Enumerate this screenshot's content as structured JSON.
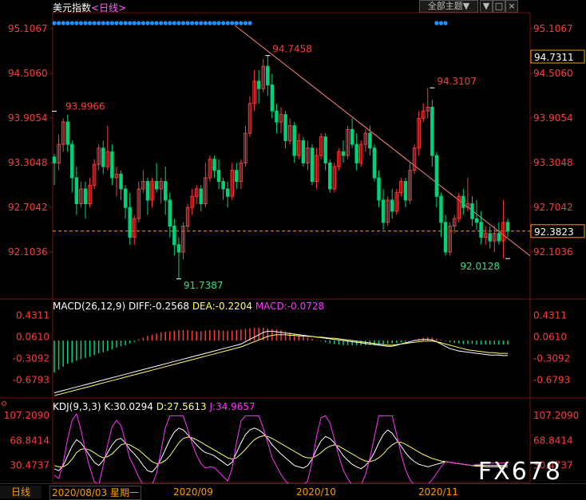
{
  "header": {
    "title": "美元指数",
    "period": "<日线>",
    "theme_button": "全部主题▼",
    "win_buttons": [
      "▼",
      "□",
      "×"
    ]
  },
  "macd": {
    "label": "MACD(26,12,9)",
    "diff": "DIFF:-0.2568",
    "dea": "DEA:-0.2204",
    "macd": "MACD:-0.0728",
    "ticks": [
      "0.4311",
      "0.0610",
      "-0.3092",
      "-0.6793"
    ]
  },
  "kdj": {
    "label": "KDJ(9,3,3)",
    "k": "K:30.0294",
    "d": "D:27.5613",
    "j": "J:34.9657",
    "ticks": [
      "107.2090",
      "68.8414",
      "30.4737"
    ]
  },
  "footer": {
    "period_button": "日线",
    "cursor_date": "2020/08/03 星期一",
    "x_labels": [
      "2020/09",
      "2020/10",
      "2020/11"
    ]
  },
  "watermark": "FX678",
  "colors": {
    "up": "#ff3b3b",
    "down": "#00d27a",
    "trendline": "#ff8080",
    "current_price_line": "#ff9900",
    "diff_line": "#ffffff",
    "dea_line": "#ffff66",
    "macd_label": "#ff33ff",
    "k_line": "#ffffff",
    "d_line": "#ffff66",
    "j_line": "#ff33ff",
    "axis_text": "#ff3b3b",
    "event_dots": "#1e90ff"
  },
  "chart_data": {
    "type": "candlestick",
    "instrument": "美元指数",
    "price_axis_ticks": [
      95.1067,
      94.506,
      93.9054,
      93.3048,
      92.7042,
      92.1036
    ],
    "current_price": "92.3823",
    "price_marker": "94.7311",
    "annotations": {
      "high_label": "94.7458",
      "high2_label": "94.3107",
      "left_label": "93.9966",
      "low_label": "91.7387",
      "low2_label": "92.0128"
    },
    "x_labels": [
      "2020/09",
      "2020/10",
      "2020/11"
    ],
    "candles": [
      [
        93.38,
        93.42,
        93.0,
        93.3
      ],
      [
        93.3,
        93.68,
        93.2,
        93.55
      ],
      [
        93.55,
        93.9,
        93.45,
        93.85
      ],
      [
        93.85,
        93.95,
        93.45,
        93.55
      ],
      [
        93.55,
        93.6,
        92.9,
        93.1
      ],
      [
        93.1,
        93.25,
        92.6,
        92.75
      ],
      [
        92.75,
        93.05,
        92.7,
        92.95
      ],
      [
        92.95,
        93.05,
        92.55,
        92.75
      ],
      [
        92.75,
        93.1,
        92.7,
        93.0
      ],
      [
        93.0,
        93.35,
        92.95,
        93.28
      ],
      [
        93.28,
        93.55,
        93.2,
        93.5
      ],
      [
        93.5,
        93.6,
        93.15,
        93.25
      ],
      [
        93.25,
        93.8,
        93.2,
        93.45
      ],
      [
        93.45,
        93.55,
        93.0,
        93.1
      ],
      [
        93.1,
        93.25,
        92.85,
        93.15
      ],
      [
        93.15,
        93.2,
        92.8,
        92.95
      ],
      [
        92.95,
        93.0,
        92.55,
        92.7
      ],
      [
        92.7,
        92.9,
        92.2,
        92.3
      ],
      [
        92.3,
        92.6,
        92.2,
        92.55
      ],
      [
        92.55,
        93.05,
        92.5,
        92.95
      ],
      [
        92.95,
        93.2,
        92.9,
        93.05
      ],
      [
        93.05,
        93.1,
        92.6,
        92.8
      ],
      [
        92.8,
        93.1,
        92.7,
        93.05
      ],
      [
        93.05,
        93.3,
        92.9,
        92.95
      ],
      [
        92.95,
        93.1,
        92.75,
        93.05
      ],
      [
        93.05,
        93.25,
        92.6,
        92.8
      ],
      [
        92.8,
        92.9,
        92.3,
        92.45
      ],
      [
        92.45,
        92.55,
        92.05,
        92.2
      ],
      [
        92.2,
        92.3,
        91.74,
        92.1
      ],
      [
        92.1,
        92.5,
        92.0,
        92.45
      ],
      [
        92.45,
        92.75,
        92.4,
        92.7
      ],
      [
        92.7,
        92.95,
        92.6,
        92.85
      ],
      [
        92.85,
        93.0,
        92.75,
        92.95
      ],
      [
        92.95,
        93.0,
        92.65,
        92.75
      ],
      [
        92.75,
        93.3,
        92.7,
        93.1
      ],
      [
        93.1,
        93.4,
        93.05,
        93.35
      ],
      [
        93.35,
        93.4,
        93.1,
        93.2
      ],
      [
        93.2,
        93.35,
        92.95,
        93.05
      ],
      [
        93.05,
        93.1,
        92.8,
        92.95
      ],
      [
        92.95,
        93.05,
        92.7,
        92.85
      ],
      [
        92.85,
        93.3,
        92.8,
        93.2
      ],
      [
        93.2,
        93.3,
        92.95,
        93.05
      ],
      [
        93.05,
        93.35,
        92.95,
        93.3
      ],
      [
        93.3,
        93.8,
        93.25,
        93.7
      ],
      [
        93.7,
        94.2,
        93.65,
        94.1
      ],
      [
        94.1,
        94.55,
        94.0,
        94.4
      ],
      [
        94.4,
        94.55,
        94.1,
        94.3
      ],
      [
        94.3,
        94.7,
        94.25,
        94.6
      ],
      [
        94.6,
        94.7458,
        94.2,
        94.35
      ],
      [
        94.35,
        94.5,
        93.9,
        94.0
      ],
      [
        94.0,
        94.1,
        93.7,
        93.85
      ],
      [
        93.85,
        94.05,
        93.7,
        93.95
      ],
      [
        93.95,
        94.0,
        93.5,
        93.6
      ],
      [
        93.6,
        93.9,
        93.55,
        93.8
      ],
      [
        93.8,
        93.85,
        93.3,
        93.4
      ],
      [
        93.4,
        93.7,
        93.35,
        93.6
      ],
      [
        93.6,
        93.65,
        93.25,
        93.3
      ],
      [
        93.3,
        93.6,
        93.2,
        93.5
      ],
      [
        93.5,
        93.55,
        93.0,
        93.05
      ],
      [
        93.05,
        93.5,
        92.95,
        93.4
      ],
      [
        93.4,
        93.7,
        93.35,
        93.65
      ],
      [
        93.65,
        93.7,
        93.2,
        93.3
      ],
      [
        93.3,
        93.35,
        92.9,
        92.95
      ],
      [
        92.95,
        93.3,
        92.9,
        93.25
      ],
      [
        93.25,
        93.5,
        93.2,
        93.45
      ],
      [
        93.45,
        93.6,
        93.3,
        93.4
      ],
      [
        93.4,
        93.8,
        93.35,
        93.75
      ],
      [
        93.75,
        93.9,
        93.5,
        93.55
      ],
      [
        93.55,
        93.7,
        93.2,
        93.3
      ],
      [
        93.3,
        93.6,
        93.25,
        93.55
      ],
      [
        93.55,
        93.75,
        93.45,
        93.7
      ],
      [
        93.7,
        93.8,
        93.4,
        93.5
      ],
      [
        93.5,
        93.55,
        93.05,
        93.1
      ],
      [
        93.1,
        93.2,
        92.7,
        92.8
      ],
      [
        92.8,
        92.95,
        92.4,
        92.5
      ],
      [
        92.5,
        92.85,
        92.45,
        92.8
      ],
      [
        92.8,
        92.95,
        92.55,
        92.65
      ],
      [
        92.65,
        92.95,
        92.6,
        92.9
      ],
      [
        92.9,
        93.1,
        92.85,
        93.05
      ],
      [
        93.05,
        93.1,
        92.7,
        92.8
      ],
      [
        92.8,
        93.3,
        92.75,
        93.2
      ],
      [
        93.2,
        93.55,
        93.15,
        93.5
      ],
      [
        93.5,
        94.0,
        93.4,
        93.9
      ],
      [
        93.9,
        94.1,
        93.85,
        94.0
      ],
      [
        94.0,
        94.3107,
        93.9,
        94.05
      ],
      [
        94.05,
        94.15,
        93.25,
        93.4
      ],
      [
        93.4,
        93.45,
        92.7,
        92.85
      ],
      [
        92.85,
        92.9,
        92.3,
        92.5
      ],
      [
        92.5,
        92.6,
        92.05,
        92.1
      ],
      [
        92.1,
        92.5,
        92.05,
        92.45
      ],
      [
        92.45,
        92.6,
        92.35,
        92.55
      ],
      [
        92.55,
        92.9,
        92.5,
        92.85
      ],
      [
        92.85,
        92.95,
        92.6,
        92.7
      ],
      [
        92.7,
        93.1,
        92.65,
        92.75
      ],
      [
        92.75,
        92.85,
        92.45,
        92.55
      ],
      [
        92.55,
        92.8,
        92.4,
        92.5
      ],
      [
        92.5,
        92.65,
        92.2,
        92.3
      ],
      [
        92.3,
        92.45,
        92.2,
        92.35
      ],
      [
        92.35,
        92.45,
        92.15,
        92.25
      ],
      [
        92.25,
        92.45,
        92.1,
        92.35
      ],
      [
        92.35,
        92.5,
        92.2,
        92.25
      ],
      [
        92.25,
        92.8,
        92.0128,
        92.5
      ],
      [
        92.5,
        92.55,
        92.3,
        92.38
      ]
    ],
    "macd_hist": [
      -0.55,
      -0.5,
      -0.45,
      -0.4,
      -0.38,
      -0.35,
      -0.32,
      -0.3,
      -0.28,
      -0.25,
      -0.22,
      -0.2,
      -0.18,
      -0.15,
      -0.12,
      -0.1,
      -0.08,
      -0.05,
      -0.02,
      0.02,
      0.05,
      0.08,
      0.1,
      0.12,
      0.14,
      0.15,
      0.16,
      0.17,
      0.18,
      0.18,
      0.18,
      0.17,
      0.16,
      0.16,
      0.17,
      0.18,
      0.18,
      0.18,
      0.17,
      0.17,
      0.17,
      0.18,
      0.19,
      0.2,
      0.21,
      0.22,
      0.22,
      0.22,
      0.21,
      0.2,
      0.19,
      0.18,
      0.16,
      0.14,
      0.12,
      0.1,
      0.08,
      0.05,
      0.03,
      0.01,
      -0.01,
      -0.03,
      -0.05,
      -0.06,
      -0.07,
      -0.08,
      -0.08,
      -0.08,
      -0.08,
      -0.08,
      -0.08,
      -0.08,
      -0.08,
      -0.08,
      -0.07,
      -0.06,
      -0.05,
      -0.04,
      -0.03,
      -0.02,
      0.0,
      0.01,
      0.03,
      0.05,
      0.06,
      0.05,
      0.03,
      0.01,
      -0.01,
      -0.03,
      -0.04,
      -0.05,
      -0.06,
      -0.06,
      -0.06,
      -0.07,
      -0.07,
      -0.07,
      -0.07,
      -0.07,
      -0.07,
      -0.07,
      -0.07
    ],
    "macd_diff": [
      -0.9,
      -0.88,
      -0.86,
      -0.84,
      -0.82,
      -0.8,
      -0.78,
      -0.76,
      -0.74,
      -0.72,
      -0.7,
      -0.68,
      -0.66,
      -0.64,
      -0.62,
      -0.6,
      -0.58,
      -0.56,
      -0.54,
      -0.52,
      -0.5,
      -0.48,
      -0.46,
      -0.44,
      -0.42,
      -0.4,
      -0.38,
      -0.36,
      -0.34,
      -0.32,
      -0.3,
      -0.28,
      -0.26,
      -0.24,
      -0.22,
      -0.2,
      -0.18,
      -0.16,
      -0.14,
      -0.12,
      -0.1,
      -0.08,
      -0.06,
      -0.02,
      0.02,
      0.06,
      0.1,
      0.14,
      0.16,
      0.16,
      0.15,
      0.14,
      0.13,
      0.12,
      0.11,
      0.1,
      0.09,
      0.08,
      0.07,
      0.06,
      0.05,
      0.04,
      0.03,
      0.02,
      0.01,
      0.0,
      -0.01,
      -0.02,
      -0.03,
      -0.04,
      -0.05,
      -0.06,
      -0.07,
      -0.08,
      -0.09,
      -0.1,
      -0.1,
      -0.08,
      -0.06,
      -0.04,
      -0.02,
      0.0,
      0.01,
      0.02,
      0.02,
      0.01,
      -0.02,
      -0.06,
      -0.1,
      -0.14,
      -0.16,
      -0.18,
      -0.19,
      -0.2,
      -0.21,
      -0.22,
      -0.23,
      -0.24,
      -0.25,
      -0.25,
      -0.25,
      -0.26,
      -0.2568
    ],
    "macd_dea": [
      -0.95,
      -0.93,
      -0.91,
      -0.89,
      -0.87,
      -0.85,
      -0.83,
      -0.81,
      -0.79,
      -0.77,
      -0.75,
      -0.73,
      -0.71,
      -0.69,
      -0.67,
      -0.65,
      -0.63,
      -0.61,
      -0.59,
      -0.57,
      -0.55,
      -0.53,
      -0.51,
      -0.49,
      -0.47,
      -0.45,
      -0.43,
      -0.41,
      -0.39,
      -0.37,
      -0.35,
      -0.33,
      -0.31,
      -0.29,
      -0.27,
      -0.25,
      -0.23,
      -0.21,
      -0.19,
      -0.17,
      -0.15,
      -0.13,
      -0.11,
      -0.08,
      -0.05,
      -0.02,
      0.01,
      0.04,
      0.07,
      0.09,
      0.1,
      0.1,
      0.1,
      0.09,
      0.09,
      0.08,
      0.08,
      0.07,
      0.07,
      0.06,
      0.06,
      0.05,
      0.04,
      0.04,
      0.03,
      0.02,
      0.01,
      0.0,
      -0.01,
      -0.02,
      -0.03,
      -0.04,
      -0.05,
      -0.06,
      -0.07,
      -0.08,
      -0.08,
      -0.07,
      -0.06,
      -0.05,
      -0.04,
      -0.03,
      -0.02,
      -0.01,
      -0.01,
      -0.01,
      -0.02,
      -0.04,
      -0.06,
      -0.08,
      -0.1,
      -0.12,
      -0.14,
      -0.16,
      -0.17,
      -0.18,
      -0.19,
      -0.2,
      -0.21,
      -0.21,
      -0.22,
      -0.22,
      -0.2204
    ],
    "kdj_k": [
      25,
      22,
      30,
      45,
      60,
      70,
      65,
      55,
      45,
      35,
      30,
      38,
      50,
      62,
      70,
      72,
      65,
      55,
      48,
      40,
      30,
      22,
      20,
      28,
      40,
      55,
      70,
      82,
      88,
      85,
      78,
      70,
      62,
      55,
      50,
      48,
      45,
      40,
      35,
      30,
      35,
      50,
      65,
      78,
      85,
      88,
      85,
      80,
      72,
      62,
      55,
      48,
      42,
      36,
      30,
      28,
      26,
      30,
      40,
      55,
      68,
      75,
      72,
      65,
      55,
      45,
      38,
      32,
      28,
      25,
      30,
      38,
      50,
      65,
      78,
      85,
      80,
      70,
      60,
      50,
      42,
      36,
      32,
      30,
      28,
      30,
      32,
      34,
      36,
      35,
      34,
      33,
      32,
      31,
      30,
      30,
      30,
      30,
      30,
      30,
      30,
      30,
      30.03
    ],
    "kdj_d": [
      30,
      28,
      28,
      32,
      40,
      50,
      55,
      56,
      54,
      50,
      45,
      42,
      44,
      48,
      55,
      62,
      64,
      62,
      58,
      54,
      48,
      42,
      36,
      33,
      34,
      38,
      45,
      55,
      65,
      72,
      74,
      73,
      70,
      66,
      62,
      58,
      54,
      50,
      46,
      42,
      40,
      42,
      48,
      55,
      63,
      70,
      74,
      76,
      75,
      72,
      68,
      64,
      60,
      56,
      52,
      48,
      44,
      42,
      42,
      45,
      50,
      56,
      60,
      62,
      60,
      56,
      52,
      48,
      44,
      40,
      37,
      36,
      38,
      42,
      48,
      56,
      62,
      66,
      66,
      63,
      59,
      55,
      51,
      47,
      44,
      41,
      39,
      37,
      36,
      35,
      34,
      33,
      32,
      31,
      30,
      29,
      29,
      28,
      28,
      28,
      28,
      28,
      27.56
    ],
    "kdj_j": [
      15,
      10,
      34,
      71,
      100,
      110,
      85,
      53,
      27,
      5,
      0,
      30,
      62,
      90,
      100,
      92,
      67,
      41,
      28,
      12,
      0,
      0,
      0,
      18,
      52,
      89,
      107,
      107,
      107,
      107,
      86,
      64,
      46,
      33,
      26,
      28,
      27,
      20,
      13,
      6,
      25,
      66,
      99,
      107,
      107,
      107,
      107,
      88,
      66,
      42,
      29,
      16,
      6,
      0,
      0,
      0,
      0,
      6,
      36,
      75,
      104,
      107,
      96,
      71,
      45,
      23,
      10,
      0,
      0,
      0,
      16,
      42,
      74,
      107,
      107,
      107,
      107,
      78,
      48,
      24,
      8,
      0,
      0,
      0,
      0,
      8,
      18,
      28,
      36,
      35,
      34,
      33,
      32,
      31,
      30,
      32,
      32,
      34,
      34,
      34,
      34,
      34,
      34.97
    ]
  }
}
